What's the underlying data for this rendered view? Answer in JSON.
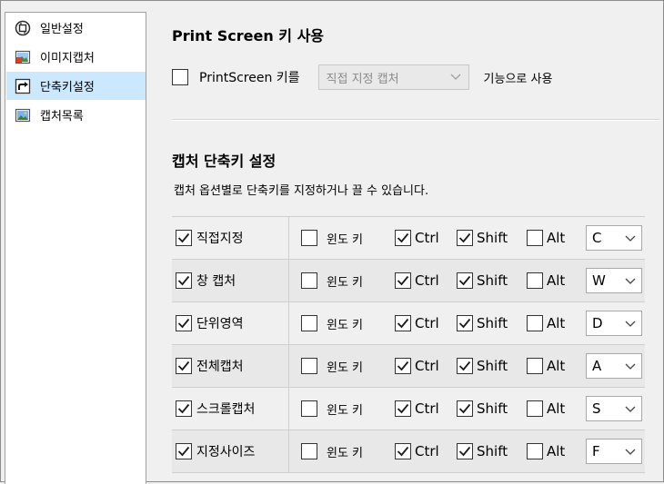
{
  "sidebar": {
    "items": [
      {
        "label": "일반설정",
        "icon": "general-settings-icon",
        "active": false
      },
      {
        "label": "이미지캡처",
        "icon": "image-capture-icon",
        "active": false
      },
      {
        "label": "단축키설정",
        "icon": "shortcut-icon",
        "active": true
      },
      {
        "label": "캡처목록",
        "icon": "capture-list-icon",
        "active": false
      }
    ]
  },
  "printscreen": {
    "title": "Print Screen 키 사용",
    "checkbox_label": "PrintScreen 키를",
    "checked": false,
    "dropdown_value": "직접 지정 캡처",
    "suffix": "기능으로 사용"
  },
  "shortcuts": {
    "title": "캡처 단축키 설정",
    "description": "캡처 옵션별로 단축키를 지정하거나 끌 수 있습니다.",
    "option_labels": {
      "win": "윈도 키",
      "ctrl": "Ctrl",
      "shift": "Shift",
      "alt": "Alt"
    },
    "rows": [
      {
        "name": "직접지정",
        "enabled": true,
        "win": false,
        "ctrl": true,
        "shift": true,
        "alt": false,
        "key": "C"
      },
      {
        "name": "창 캡처",
        "enabled": true,
        "win": false,
        "ctrl": true,
        "shift": true,
        "alt": false,
        "key": "W"
      },
      {
        "name": "단위영역",
        "enabled": true,
        "win": false,
        "ctrl": true,
        "shift": true,
        "alt": false,
        "key": "D"
      },
      {
        "name": "전체캡처",
        "enabled": true,
        "win": false,
        "ctrl": true,
        "shift": true,
        "alt": false,
        "key": "A"
      },
      {
        "name": "스크롤캡처",
        "enabled": true,
        "win": false,
        "ctrl": true,
        "shift": true,
        "alt": false,
        "key": "S"
      },
      {
        "name": "지정사이즈",
        "enabled": true,
        "win": false,
        "ctrl": true,
        "shift": true,
        "alt": false,
        "key": "F"
      }
    ]
  },
  "colors": {
    "selection": "#cce8ff",
    "panel_bg": "#f0f0f0",
    "stripe": "#e8e8e8"
  }
}
